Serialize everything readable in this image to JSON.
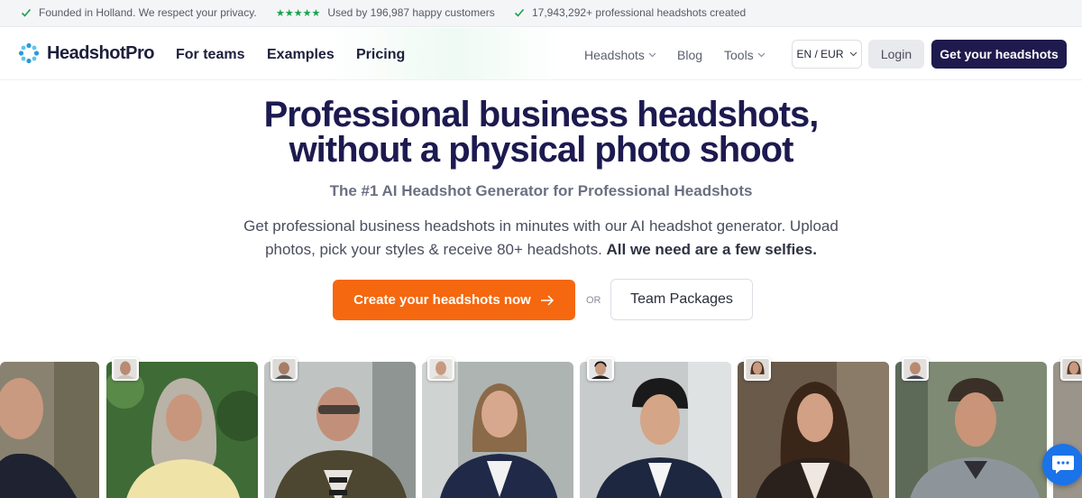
{
  "topbar": {
    "items": [
      {
        "text": "Founded in Holland. We respect your privacy."
      },
      {
        "stars": "★★★★★",
        "text": "Used by 196,987 happy customers"
      },
      {
        "text": "17,943,292+ professional headshots created"
      }
    ]
  },
  "nav": {
    "logo": "HeadshotPro",
    "main_links": [
      "For teams",
      "Examples",
      "Pricing"
    ],
    "secondary_links": [
      "Headshots",
      "Blog",
      "Tools"
    ],
    "language": "EN / EUR",
    "login": "Login",
    "cta": "Get your headshots"
  },
  "hero": {
    "title_line1": "Professional business headshots,",
    "title_line2": "without a physical photo shoot",
    "subtitle": "The #1 AI Headshot Generator for Professional Headshots",
    "description": "Get professional business headshots in minutes with our AI headshot generator. Upload photos, pick your styles & receive 80+ headshots.",
    "description_bold": "All we need are a few selfies.",
    "primary_button": "Create your headshots now",
    "primary_button_icon": "arrow-right-icon",
    "or_text": "OR",
    "secondary_button": "Team Packages"
  },
  "colors": {
    "brand_dark": "#1e1a4d",
    "accent_orange": "#f5680f",
    "check_green": "#16a34a",
    "chat_blue": "#1a73e8"
  }
}
